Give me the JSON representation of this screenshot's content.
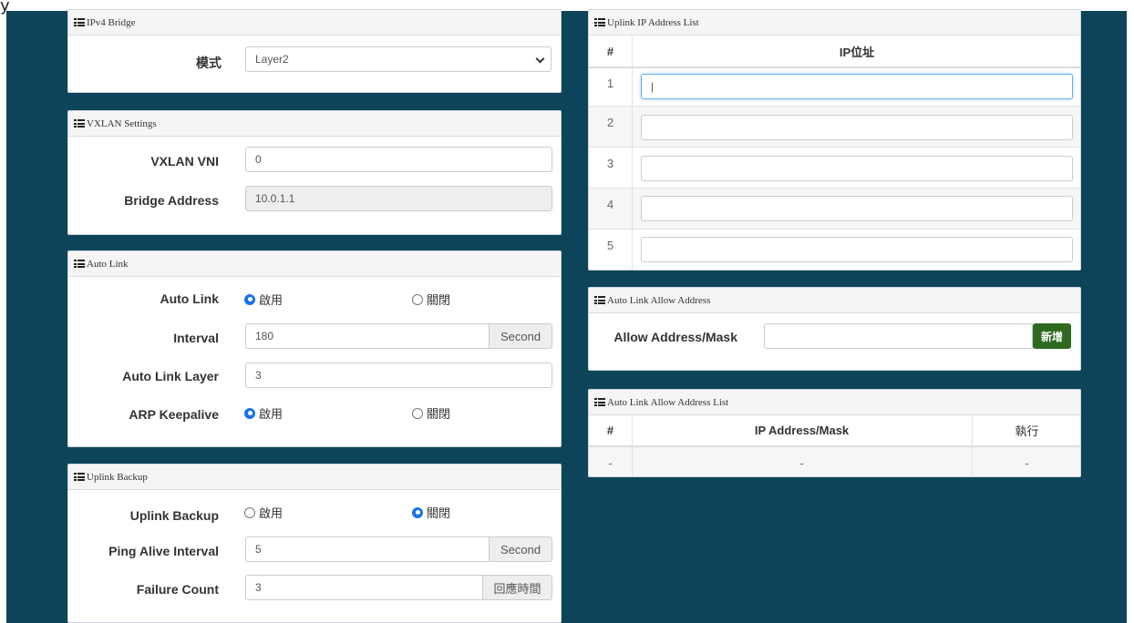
{
  "corner_glyph": "y",
  "ipv4_bridge": {
    "title": "IPv4 Bridge",
    "mode_label": "模式",
    "mode_value": "Layer2"
  },
  "vxlan": {
    "title": "VXLAN Settings",
    "vni_label": "VXLAN VNI",
    "vni_value": "0",
    "bridge_label": "Bridge Address",
    "bridge_value": "10.0.1.1"
  },
  "auto_link": {
    "title": "Auto Link",
    "auto_link_label": "Auto Link",
    "enable_label": "啟用",
    "disable_label": "關閉",
    "interval_label": "Interval",
    "interval_value": "180",
    "interval_unit": "Second",
    "layer_label": "Auto Link Layer",
    "layer_value": "3",
    "arp_label": "ARP Keepalive",
    "arp_enable_label": "啟用",
    "arp_disable_label": "關閉",
    "auto_link_selected": "enable",
    "arp_selected": "enable"
  },
  "uplink_backup": {
    "title": "Uplink Backup",
    "backup_label": "Uplink Backup",
    "enable_label": "啟用",
    "disable_label": "關閉",
    "selected": "disable",
    "ping_label": "Ping Alive Interval",
    "ping_value": "5",
    "ping_unit": "Second",
    "failure_label": "Failure Count",
    "failure_value": "3",
    "failure_unit": "回應時間"
  },
  "uplink_ip_list": {
    "title": "Uplink IP Address List",
    "col_index": "#",
    "col_ip": "IP位址",
    "rows": [
      {
        "index": "1",
        "value": "|"
      },
      {
        "index": "2",
        "value": ""
      },
      {
        "index": "3",
        "value": ""
      },
      {
        "index": "4",
        "value": ""
      },
      {
        "index": "5",
        "value": ""
      }
    ]
  },
  "allow_address": {
    "title": "Auto Link Allow Address",
    "label": "Allow Address/Mask",
    "value": "",
    "add_button": "新增"
  },
  "allow_list": {
    "title": "Auto Link Allow Address List",
    "col_index": "#",
    "col_ip": "IP Address/Mask",
    "col_action": "執行",
    "rows": [
      {
        "index": "-",
        "ip": "-",
        "action": "-"
      }
    ]
  }
}
